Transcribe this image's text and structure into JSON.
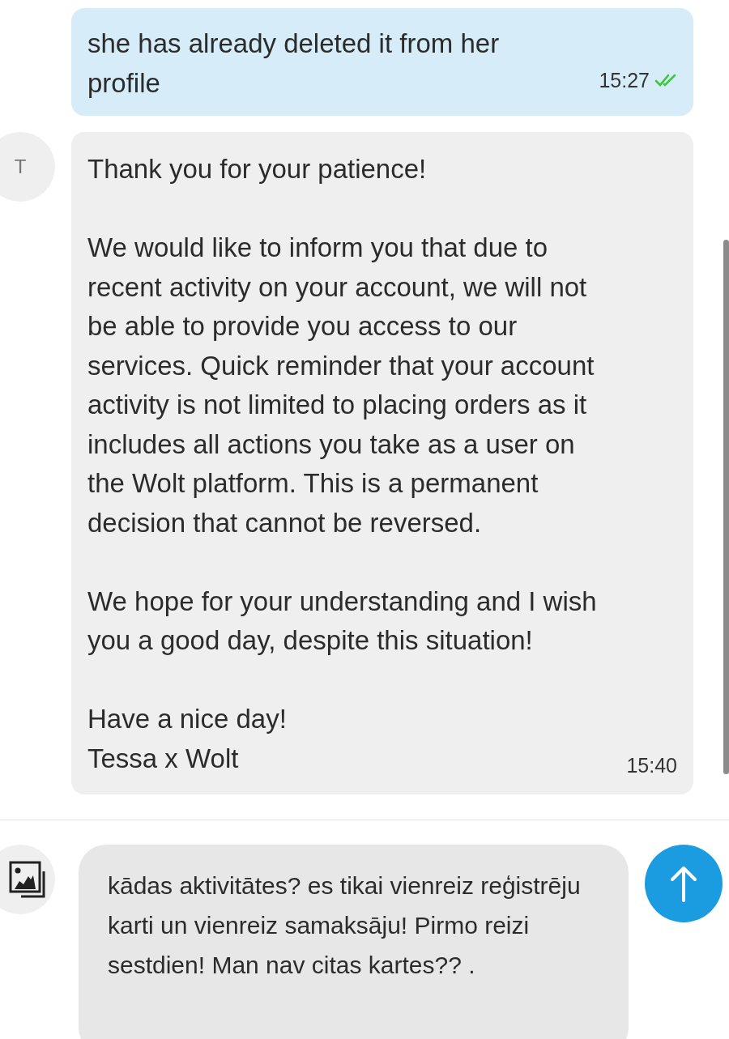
{
  "messages": [
    {
      "paragraphs": [
        "she has already deleted it from her profile"
      ],
      "time": "15:27",
      "read": true
    },
    {
      "avatar": "T",
      "paragraphs": [
        "Thank you for your patience!",
        "We would like to inform you that due to recent activity on your account, we will not be able to provide you access to our services. Quick reminder that your account activity is not limited to placing orders as it includes all actions you take as a user on the Wolt platform. This is a permanent decision that cannot be reversed.",
        "We hope for your understanding and I wish you a good day, despite this situation!",
        "Have a nice day!\nTessa x Wolt"
      ],
      "time": "15:40"
    }
  ],
  "composer": {
    "value": "kādas aktivitātes? es tikai vienreiz reģistrēju karti un vienreiz samaksāju! Pirmo reizi sestdien! Man nav citas kartes?? ."
  }
}
